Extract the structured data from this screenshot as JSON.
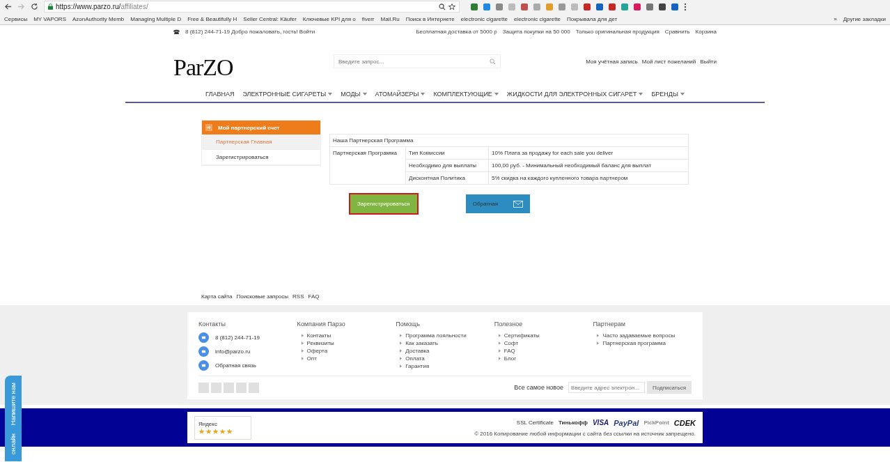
{
  "browser": {
    "url_host": "https://www.parzo.ru/",
    "url_path": "affiliates/",
    "bookmarks": [
      "Сервисы",
      "MY VAPORS",
      "AzonAuthority Memb",
      "Managing Multiple D",
      "Free & Beautifully H",
      "Seller Central: Käufer",
      "Ключевые KPI для o",
      "fiverr",
      "Mail.Ru",
      "Поиск в Интернете",
      "electronic cigarette",
      "electronic cigarette",
      "Покрывала для дет"
    ],
    "more": "»",
    "other_bookmarks": "Другие закладки"
  },
  "topbar": {
    "left": "8 (812) 244-71-19 Добро пожаловать, гость! Войти",
    "right": [
      "Бесплатная доставка от 5000 р",
      "Защита покупки на 50 000",
      "Только оригинальная продукция",
      "Сравнить",
      "Корзина"
    ]
  },
  "header": {
    "logo": "ParZO",
    "search_placeholder": "Введите запрос...",
    "account_links": [
      "Моя учётная запись",
      "Мой лист пожеланий",
      "Выйти"
    ]
  },
  "nav": [
    {
      "label": "ГЛАВНАЯ",
      "has_dropdown": false
    },
    {
      "label": "ЭЛЕКТРОННЫЕ СИГАРЕТЫ",
      "has_dropdown": true
    },
    {
      "label": "МОДЫ",
      "has_dropdown": true
    },
    {
      "label": "АТОМАЙЗЕРЫ",
      "has_dropdown": true
    },
    {
      "label": "КОМПЛЕКТУЮЩИЕ",
      "has_dropdown": true
    },
    {
      "label": "ЖИДКОСТИ ДЛЯ ЭЛЕКТРОННЫХ СИГАРЕТ",
      "has_dropdown": true
    },
    {
      "label": "БРЕНДЫ",
      "has_dropdown": true
    }
  ],
  "sidebar": {
    "title": "Мой партнерский счет",
    "items": [
      {
        "label": "Партнерская Главная",
        "selected": true
      },
      {
        "label": "Зарегистрироваться",
        "selected": false
      }
    ]
  },
  "program_table": {
    "title": "Наша Партнерская Программа",
    "section": "Партнерская Программа",
    "rows": [
      {
        "name": "Тип Комиссии",
        "value": "10% Плата за продажу for each sale you deliver"
      },
      {
        "name": "Необходимо для выплаты",
        "value": "100,00 руб. - Минимальный необходимый баланс для выплат"
      },
      {
        "name": "Дисконтная Политика",
        "value": "5% скидка на каждого купленного товара партнером"
      }
    ]
  },
  "buttons": [
    {
      "label": "Зарегистрироваться",
      "kind": "register"
    },
    {
      "label": "Обратная",
      "kind": "contact"
    }
  ],
  "footer_links": [
    "Карта сайта",
    "Поисковые запросы",
    "RSS",
    "FAQ"
  ],
  "footer": {
    "columns": [
      {
        "title": "Контакты",
        "kind": "contacts",
        "items": [
          "8 (812) 244-71-19",
          "info@parzo.ru",
          "Обратная связь"
        ]
      },
      {
        "title": "Компания Парзо",
        "kind": "links",
        "items": [
          "Контакты",
          "Реквизиты",
          "Оферта",
          "Опт"
        ]
      },
      {
        "title": "Помощь",
        "kind": "links",
        "items": [
          "Программа лояльности",
          "Как заказать",
          "Доставка",
          "Оплата",
          "Гарантия"
        ]
      },
      {
        "title": "Полезное",
        "kind": "links",
        "items": [
          "Сертификаты",
          "Софт",
          "FAQ",
          "Блог"
        ]
      },
      {
        "title": "Партнерам",
        "kind": "links",
        "items": [
          "Часто задаваемые вопросы",
          "Партнерская программа"
        ]
      }
    ],
    "newsletter_label": "Все самое новое",
    "newsletter_placeholder": "Введите адрес электрон...",
    "subscribe": "Подписаться"
  },
  "bottom": {
    "rating_title": "Яндекс",
    "stars": 5,
    "payments": [
      "SSL Certificate",
      "Тинькофф",
      "VISA",
      "PayPal",
      "PickPoint",
      "CDEK"
    ],
    "copyright": "© 2016 Копирование любой информации с сайта без ссылки на источник запрещено."
  },
  "side_tab": [
    "Напишите нам",
    "онлайн"
  ]
}
